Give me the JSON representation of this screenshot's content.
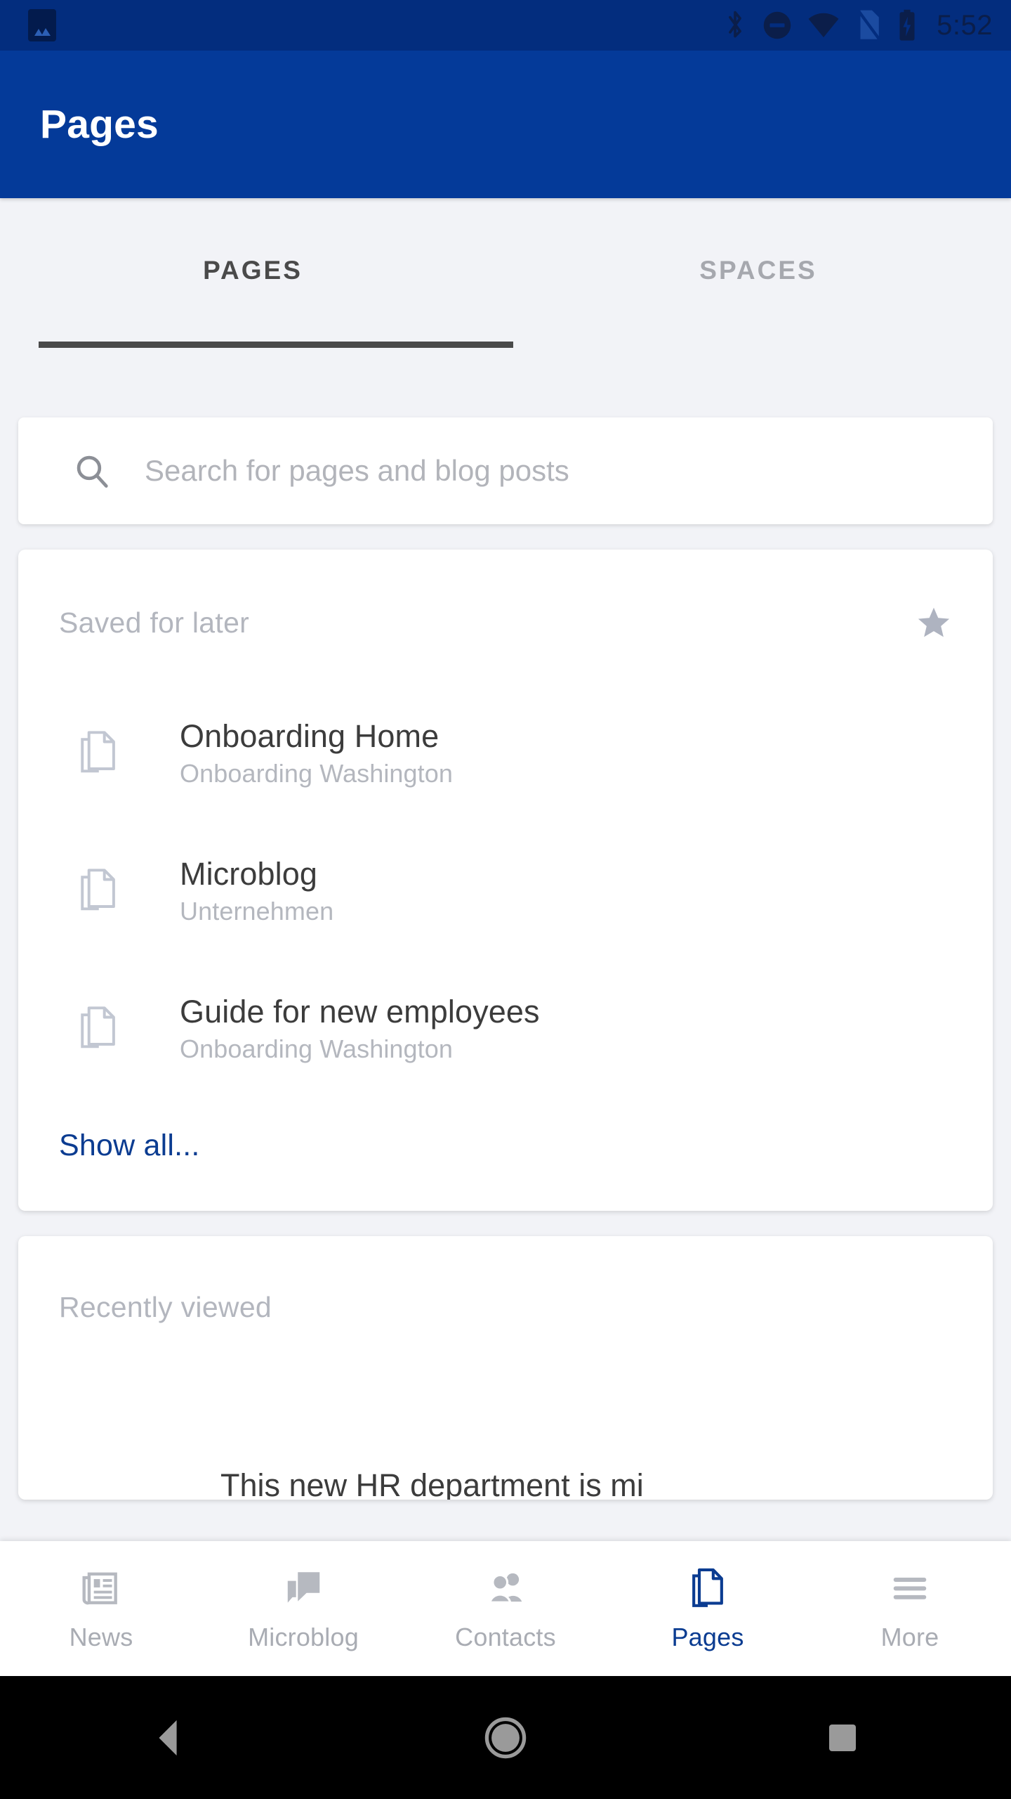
{
  "status_bar": {
    "time": "5:52",
    "icons": [
      "photo-badge-icon",
      "bluetooth-icon",
      "do-not-disturb-icon",
      "wifi-icon",
      "no-sim-icon",
      "battery-charging-icon"
    ],
    "background_color": "#032D7E"
  },
  "app_bar": {
    "title": "Pages",
    "background_color": "#043A99",
    "title_color": "#FFFFFF"
  },
  "tabs": {
    "items": [
      {
        "label": "PAGES",
        "active": true
      },
      {
        "label": "SPACES",
        "active": false
      }
    ],
    "indicator_color": "#4A4A4A",
    "active_color": "#4A4A4A",
    "inactive_color": "#A6A8AE"
  },
  "search": {
    "placeholder": "Search for pages and blog posts",
    "value": "",
    "icon": "search-icon"
  },
  "saved_card": {
    "title": "Saved for later",
    "star_icon": "star-filled-icon",
    "star_color": "#AEB3C0",
    "items": [
      {
        "title": "Onboarding Home",
        "space": "Onboarding Washington",
        "icon": "page-document-icon"
      },
      {
        "title": "Microblog",
        "space": "Unternehmen",
        "icon": "page-document-icon"
      },
      {
        "title": "Guide for new employees",
        "space": "Onboarding Washington",
        "icon": "page-document-icon"
      }
    ],
    "show_all_label": "Show all...",
    "link_color": "#0B3C91"
  },
  "recent_card": {
    "title": "Recently viewed",
    "cut_off_text": "This new HR department is mi"
  },
  "bottom_nav": {
    "items": [
      {
        "label": "News",
        "icon": "newspaper-icon",
        "active": false
      },
      {
        "label": "Microblog",
        "icon": "speech-bubble-icon",
        "active": false
      },
      {
        "label": "Contacts",
        "icon": "people-icon",
        "active": false
      },
      {
        "label": "Pages",
        "icon": "document-icon",
        "active": true
      },
      {
        "label": "More",
        "icon": "hamburger-menu-icon",
        "active": false
      }
    ],
    "active_color": "#0B3C91",
    "inactive_color": "#A9ACB3"
  },
  "android_nav": {
    "buttons": [
      "back-triangle-icon",
      "home-circle-icon",
      "recents-square-icon"
    ],
    "icon_color": "#9A9A9A",
    "background_color": "#000000"
  }
}
